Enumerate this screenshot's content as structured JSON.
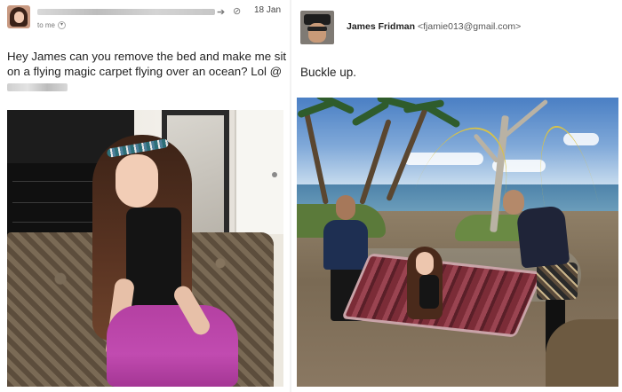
{
  "left_email": {
    "date": "18 Jan",
    "recipient_label": "to me",
    "message_text": "Hey James can you remove the bed and make me sit on a flying magic carpet flying over an ocean? Lol @",
    "icons": [
      "avatar",
      "forward-arrow-icon",
      "attachment-icon",
      "dropdown-icon"
    ]
  },
  "right_email": {
    "sender_name": "James Fridman",
    "sender_email": "<fjamie013@gmail.com>",
    "message_text": "Buckle up.",
    "icons": [
      "avatar"
    ]
  },
  "colors": {
    "background": "#ffffff",
    "text": "#222222",
    "muted": "#777777"
  }
}
